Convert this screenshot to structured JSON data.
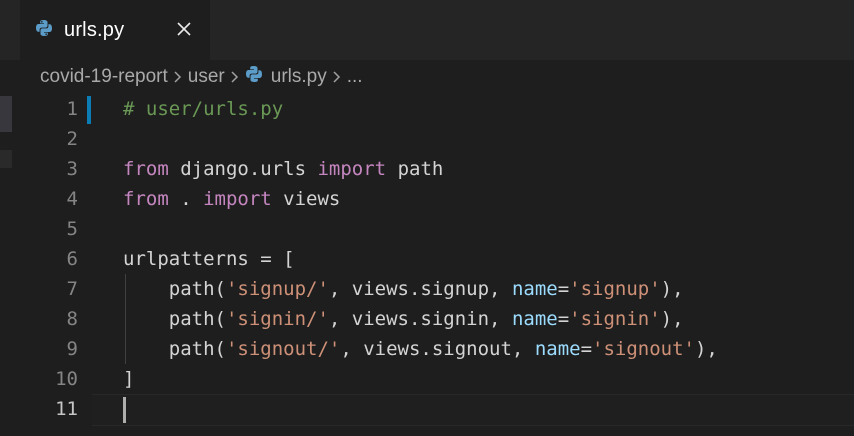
{
  "tab": {
    "label": "urls.py",
    "icon": "python-icon",
    "close_icon": "close-icon"
  },
  "breadcrumb": {
    "items": [
      "covid-19-report",
      "user",
      "urls.py",
      "..."
    ]
  },
  "colors": {
    "background": "#1e1e1e",
    "keyword": "#c586c0",
    "comment": "#6a9955",
    "string": "#ce9178",
    "parameter": "#9cdcfe",
    "text": "#d4d4d4",
    "git_modified": "#0c7db4"
  },
  "editor": {
    "line_numbers": [
      "1",
      "2",
      "3",
      "4",
      "5",
      "6",
      "7",
      "8",
      "9",
      "10",
      "11"
    ],
    "lines": {
      "l1": {
        "comment": "# user/urls.py"
      },
      "l3": {
        "kw1": "from",
        "t1": " django.urls ",
        "kw2": "import",
        "t2": " path"
      },
      "l4": {
        "kw1": "from",
        "t1": " . ",
        "kw2": "import",
        "t2": " views"
      },
      "l6": {
        "t1": "urlpatterns = ["
      },
      "l7": {
        "t1": "    path(",
        "s1": "'signup/'",
        "t2": ", views.signup, ",
        "p": "name",
        "t3": "=",
        "s2": "'signup'",
        "t4": "),"
      },
      "l8": {
        "t1": "    path(",
        "s1": "'signin/'",
        "t2": ", views.signin, ",
        "p": "name",
        "t3": "=",
        "s2": "'signin'",
        "t4": "),"
      },
      "l9": {
        "t1": "    path(",
        "s1": "'signout/'",
        "t2": ", views.signout, ",
        "p": "name",
        "t3": "=",
        "s2": "'signout'",
        "t4": "),"
      },
      "l10": {
        "t1": "]"
      }
    }
  }
}
